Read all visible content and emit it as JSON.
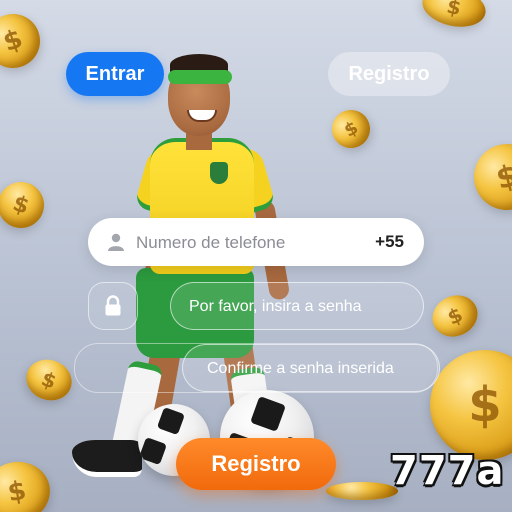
{
  "header": {
    "login_label": "Entrar",
    "register_tab_label": "Registro"
  },
  "form": {
    "phone": {
      "placeholder": "Numero de telefone",
      "value": "",
      "country_code": "+55",
      "icon": "user-icon"
    },
    "password": {
      "placeholder": "Por favor, insira a senha",
      "value": "",
      "icon": "lock-icon"
    },
    "confirm_password": {
      "placeholder": "Confirme a senha inserida",
      "value": ""
    },
    "submit_label": "Registro"
  },
  "brand": {
    "name": "777a"
  },
  "colors": {
    "primary_blue": "#1677f2",
    "accent_orange": "#f16a0c",
    "jersey_yellow": "#ffe23a",
    "jersey_green": "#2c9a3e",
    "coin_gold": "#f5c542"
  },
  "decorations": {
    "coin_symbol": "$"
  }
}
